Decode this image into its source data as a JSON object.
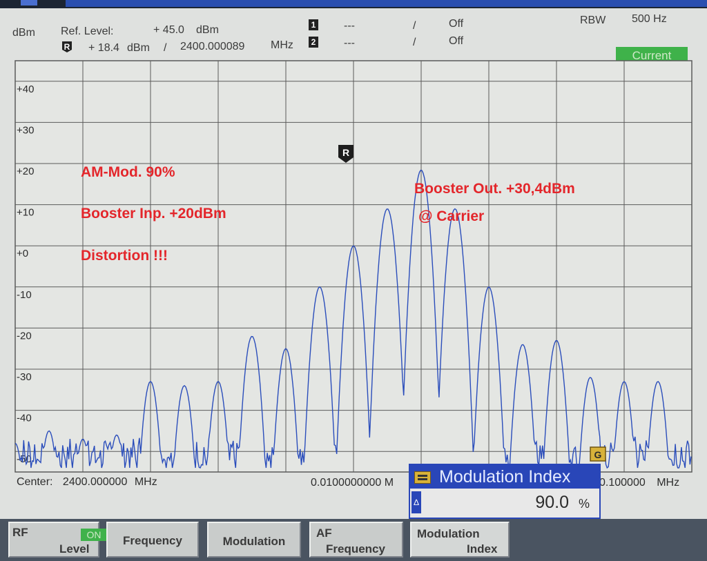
{
  "header": {
    "unit": "dBm",
    "ref_level_label": "Ref. Level:",
    "ref_level_value": "+ 45.0",
    "ref_level_unit": "dBm",
    "marker_r_value": "+ 18.4",
    "marker_r_unit": "dBm",
    "marker_r_sep": "/",
    "marker_r_freq": "2400.000089",
    "marker_r_freq_unit": "MHz",
    "marker1_value": "---",
    "marker1_sep": "/",
    "marker1_state": "Off",
    "marker2_value": "---",
    "marker2_sep": "/",
    "marker2_state": "Off",
    "rbw_label": "RBW",
    "rbw_value": "500 Hz",
    "trace_mode": "Current",
    "marker1_icon": "1",
    "marker2_icon": "2",
    "marker_r_icon": "R"
  },
  "plot": {
    "y_tick_labels": [
      "+40",
      "+30",
      "+20",
      "+10",
      "+0",
      "-10",
      "-20",
      "-30",
      "-40",
      "-50"
    ],
    "center_label": "Center:",
    "center_value": "2400.000000",
    "center_unit": "MHz",
    "span_value": "0.0100000000 M",
    "stop_value": "0.100000",
    "stop_unit": "MHz",
    "marker_r_label": "R",
    "marker_end_label": "G"
  },
  "annotations": {
    "line1": "AM-Mod. 90%",
    "line2": "Booster Inp. +20dBm",
    "line3": "Distortion !!!",
    "line4": "Booster Out. +30,4dBm",
    "line5": "@ Carrier"
  },
  "dialog": {
    "title": "Modulation Index",
    "value": "90.0",
    "unit": "%",
    "delta_symbol": "∆"
  },
  "softkeys": {
    "rf_label": "RF",
    "rf_state": "ON",
    "rf_level": "Level",
    "frequency": "Frequency",
    "modulation": "Modulation",
    "af_top": "AF",
    "af_bottom": "Frequency",
    "mi_top": "Modulation",
    "mi_bottom": "Index"
  },
  "colors": {
    "trace": "#2a4dbb",
    "grid": "#5a5a5a",
    "annotation": "#e3262b",
    "current_badge": "#3fb24a",
    "dialog_accent": "#2946b8"
  },
  "chart_data": {
    "type": "line",
    "xlabel": "",
    "ylabel": "",
    "ylim": [
      -55,
      45
    ],
    "y_ticks": [
      40,
      30,
      20,
      10,
      0,
      -10,
      -20,
      -30,
      -40,
      -50
    ],
    "y_unit": "dBm",
    "grid": true,
    "center_freq_mhz": 2400.0,
    "span_mhz": 0.1,
    "trace_peaks": {
      "offset_khz": [
        -50,
        -45,
        -40,
        -35,
        -30,
        -25,
        -20,
        -15,
        -10,
        -5,
        0,
        5,
        10,
        15,
        20,
        25,
        30,
        35,
        40,
        45
      ],
      "level_dbm": [
        -48,
        -45,
        -47,
        -46,
        -33,
        -34,
        -33,
        -22,
        -25,
        -10,
        0,
        9,
        18.4,
        9,
        -10,
        -24,
        -23,
        -32,
        -33,
        -33
      ],
      "noise_floor_dbm": -51
    }
  }
}
